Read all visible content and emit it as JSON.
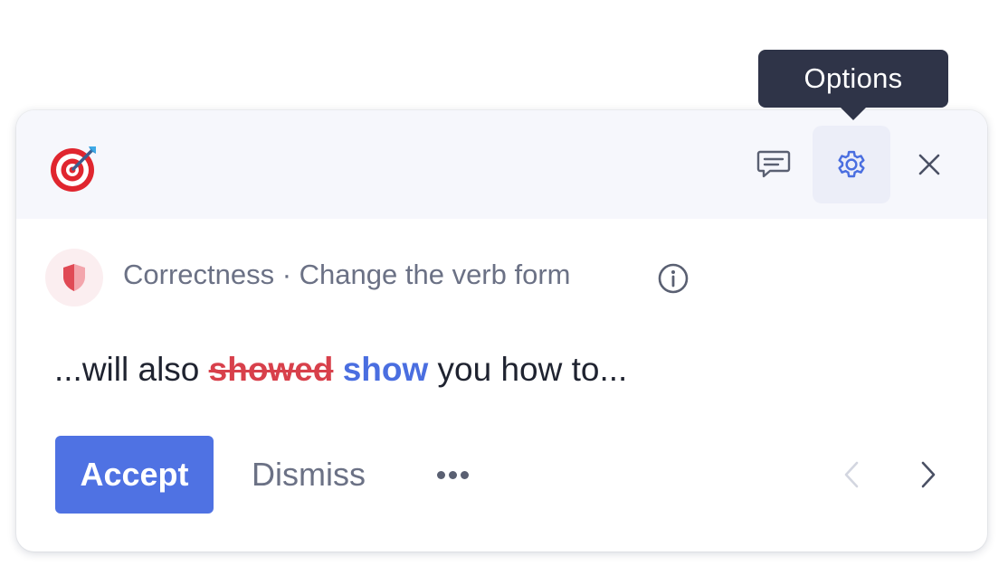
{
  "tooltip": {
    "text": "Options"
  },
  "header": {
    "logo_icon": "target-icon",
    "feedback_icon": "chat-bubble-icon",
    "options_icon": "gear-icon",
    "close_icon": "close-icon"
  },
  "category": {
    "icon": "shield-icon",
    "text": "Correctness · Change the verb form",
    "info_icon": "info-icon"
  },
  "suggestion": {
    "prefix": "...will also ",
    "original": "showed",
    "replacement": "show",
    "suffix": " you how to..."
  },
  "actions": {
    "accept_label": "Accept",
    "dismiss_label": "Dismiss",
    "more_icon": "more-dots-icon",
    "prev_icon": "chevron-left-icon",
    "next_icon": "chevron-right-icon"
  },
  "colors": {
    "accent": "#4f72e3",
    "error": "#d8404b",
    "tooltip_bg": "#2f3448",
    "header_bg": "#f6f7fc"
  }
}
